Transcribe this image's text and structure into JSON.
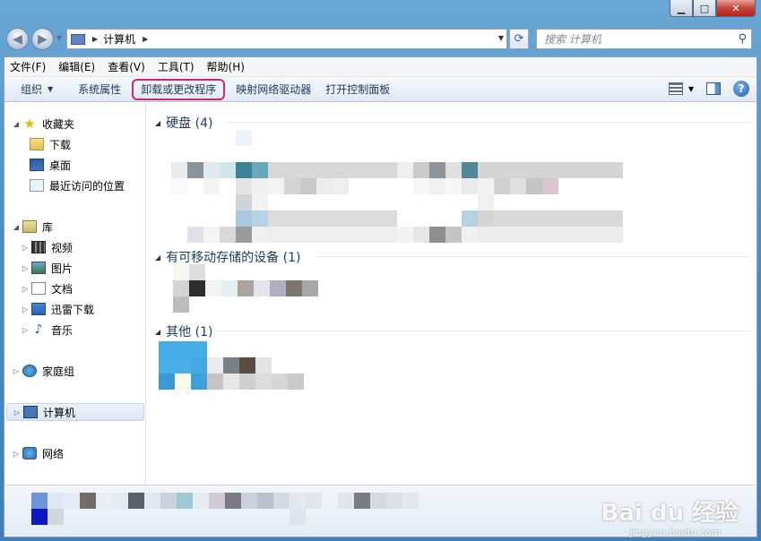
{
  "window": {
    "caption_buttons": {
      "minimize": "▁",
      "maximize": "□",
      "close": "✕"
    }
  },
  "address_bar": {
    "path": [
      "计算机"
    ],
    "back_icon": "back-arrow-icon",
    "forward_icon": "forward-arrow-icon"
  },
  "search": {
    "placeholder": "搜索 计算机"
  },
  "menu": {
    "items": [
      "文件(F)",
      "编辑(E)",
      "查看(V)",
      "工具(T)",
      "帮助(H)"
    ]
  },
  "toolbar": {
    "organize": "组织",
    "system_properties": "系统属性",
    "uninstall": "卸载或更改程序",
    "map_drive": "映射网络驱动器",
    "control_panel": "打开控制面板",
    "highlight_color": "#d2266c"
  },
  "nav": {
    "favorites": "收藏夹",
    "downloads": "下载",
    "desktop": "桌面",
    "recent": "最近访问的位置",
    "libraries": "库",
    "video": "视频",
    "pictures": "图片",
    "documents": "文档",
    "xunlei": "迅雷下载",
    "music": "音乐",
    "homegroup": "家庭组",
    "computer": "计算机",
    "network": "网络"
  },
  "groups": {
    "hdd": "硬盘 (4)",
    "removable": "有可移动存储的设备 (1)",
    "other": "其他 (1)"
  },
  "watermark": {
    "brand": "Bai du 经验",
    "url": "jingyan.baidu.com"
  }
}
